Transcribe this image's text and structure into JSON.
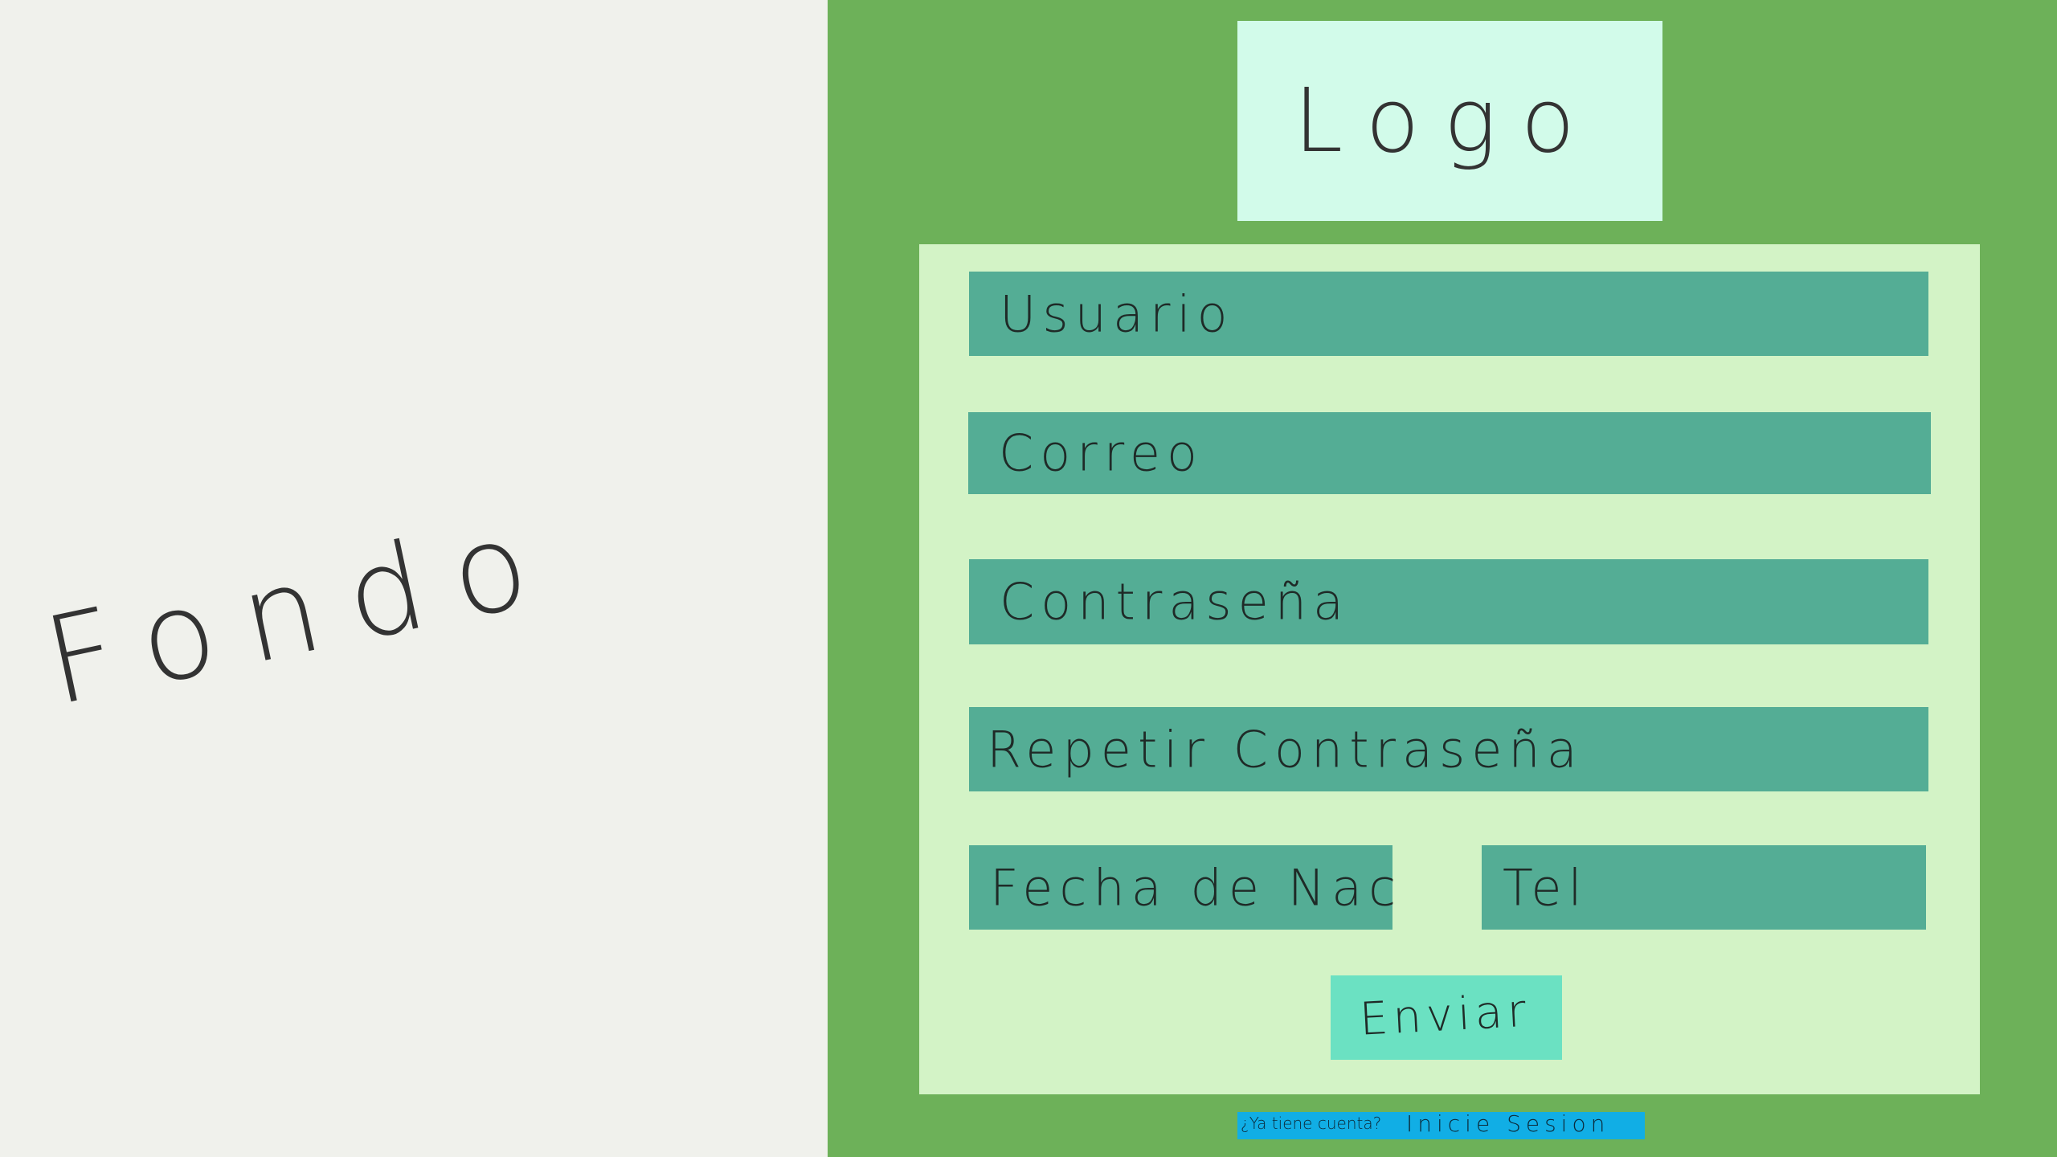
{
  "background_panel": {
    "label": "Fondo"
  },
  "logo": {
    "label": "Logo"
  },
  "form": {
    "fields": {
      "usuario": "Usuario",
      "correo": "Correo",
      "contrasena": "Contraseña",
      "repetir_contrasena": "Repetir Contraseña",
      "fecha_nac": "Fecha de Nac",
      "tel": "Tel"
    },
    "submit_label": "Enviar"
  },
  "footer": {
    "question": "¿Ya tiene cuenta?",
    "action": "Inicie Sesion"
  },
  "colors": {
    "left_background": "#f0f1ec",
    "right_background": "#6db159",
    "logo_box": "#d2fbea",
    "form_card": "#d3f3c6",
    "field": "#54ad95",
    "submit_button": "#6be1c2",
    "login_link": "#11aee5"
  }
}
